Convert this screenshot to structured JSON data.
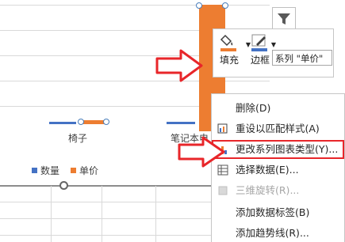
{
  "chart": {
    "categories": [
      {
        "label": "椅子"
      },
      {
        "label": "笔记本电"
      }
    ],
    "legend": [
      {
        "name": "数量",
        "color": "#4472c4"
      },
      {
        "name": "单价",
        "color": "#ed7d31"
      }
    ]
  },
  "toolbar": {
    "fill_label": "填充",
    "border_label": "边框",
    "series_selector_value": "系列 \"单价\""
  },
  "context_menu": {
    "items": [
      {
        "label": "删除(D)",
        "enabled": true,
        "highlighted": false
      },
      {
        "label": "重设以匹配样式(A)",
        "enabled": true,
        "highlighted": false
      },
      {
        "label": "更改系列图表类型(Y)...",
        "enabled": true,
        "highlighted": true
      },
      {
        "label": "选择数据(E)...",
        "enabled": true,
        "highlighted": false
      },
      {
        "label": "三维旋转(R)...",
        "enabled": false,
        "highlighted": false
      },
      {
        "label": "添加数据标签(B)",
        "enabled": true,
        "highlighted": false
      },
      {
        "label": "添加趋势线(R)...",
        "enabled": true,
        "highlighted": false
      }
    ]
  },
  "colors": {
    "series_quantity": "#4472c4",
    "series_price": "#ed7d31",
    "annotation_red": "#e8262a"
  }
}
